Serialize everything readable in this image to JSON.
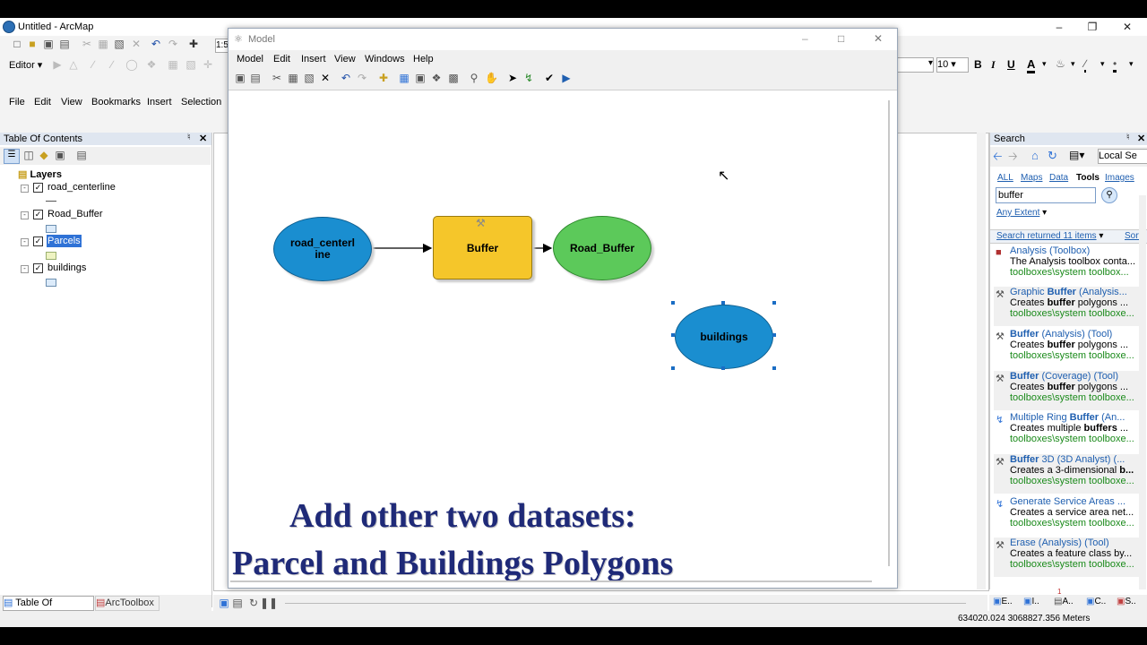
{
  "app": {
    "title": "Untitled - ArcMap",
    "menu": [
      "File",
      "Edit",
      "View",
      "Bookmarks",
      "Insert",
      "Selection"
    ],
    "editor_label": "Editor",
    "scale_fragment": "1:5",
    "font_size_value": "10",
    "format_buttons": [
      "B",
      "I",
      "U"
    ]
  },
  "toc": {
    "title": "Table Of Contents",
    "root": "Layers",
    "layers": [
      {
        "name": "road_centerline",
        "checked": true
      },
      {
        "name": "Road_Buffer",
        "checked": true
      },
      {
        "name": "Parcels",
        "checked": true,
        "selected": true
      },
      {
        "name": "buildings",
        "checked": true
      }
    ],
    "bottom_tabs": [
      "Table Of Contents",
      "ArcToolbox"
    ]
  },
  "model": {
    "title": "Model",
    "menu": [
      "Model",
      "Edit",
      "Insert",
      "View",
      "Windows",
      "Help"
    ],
    "nodes": {
      "input": "road_centerl\nine",
      "tool": "Buffer",
      "output": "Road_Buffer",
      "new_input": "buildings"
    },
    "caption_line1": "Add other two datasets:",
    "caption_line2": "Parcel and Buildings Polygons"
  },
  "search": {
    "title": "Search",
    "local": "Local Se",
    "tabs": [
      "ALL",
      "Maps",
      "Data",
      "Tools",
      "Images"
    ],
    "query": "buffer",
    "extent": "Any Extent",
    "returned": "Search returned 11 items",
    "sort": "Sort",
    "results": [
      {
        "t1": "Analysis",
        "t2": " (Toolbox)",
        "d1": "The Analysis toolbox conta...",
        "d2": "",
        "d3": "",
        "path": "toolboxes\\system toolbox..."
      },
      {
        "t1": "Graphic ",
        "t2": "Buffer",
        "t3": " (Analysis...",
        "d1": "Creates ",
        "d2": "buffer",
        "d3": " polygons ...",
        "path": "toolboxes\\system toolboxe..."
      },
      {
        "t1": "",
        "t2": "Buffer",
        "t3": " (Analysis) (Tool)",
        "d1": "Creates ",
        "d2": "buffer",
        "d3": " polygons ...",
        "path": "toolboxes\\system toolboxe..."
      },
      {
        "t1": "",
        "t2": "Buffer",
        "t3": " (Coverage) (Tool)",
        "d1": "Creates ",
        "d2": "buffer",
        "d3": " polygons ...",
        "path": "toolboxes\\system toolboxe..."
      },
      {
        "t1": "Multiple Ring ",
        "t2": "Buffer",
        "t3": " (An...",
        "d1": "Creates multiple ",
        "d2": "buffers",
        "d3": " ...",
        "path": "toolboxes\\system toolboxe..."
      },
      {
        "t1": "",
        "t2": "Buffer",
        "t3": " 3D (3D Analyst) (...",
        "d1": "Creates a 3-dimensional ",
        "d2": "b...",
        "d3": "",
        "path": "toolboxes\\system toolboxe..."
      },
      {
        "t1": "Generate Service Areas ...",
        "t2": "",
        "t3": "",
        "d1": "Creates a service area net...",
        "d2": "",
        "d3": "",
        "path": "toolboxes\\system toolboxe..."
      },
      {
        "t1": "Erase (Analysis) (Tool)",
        "t2": "",
        "t3": "",
        "d1": "Creates a feature class by...",
        "d2": "",
        "d3": "",
        "path": "toolboxes\\system toolboxe..."
      }
    ],
    "bottom_tabs": [
      "E..",
      "I..",
      "A..",
      "C..",
      "S.."
    ],
    "badge": "1"
  },
  "status": {
    "coords": "634020.024  3068827.356 Meters"
  }
}
